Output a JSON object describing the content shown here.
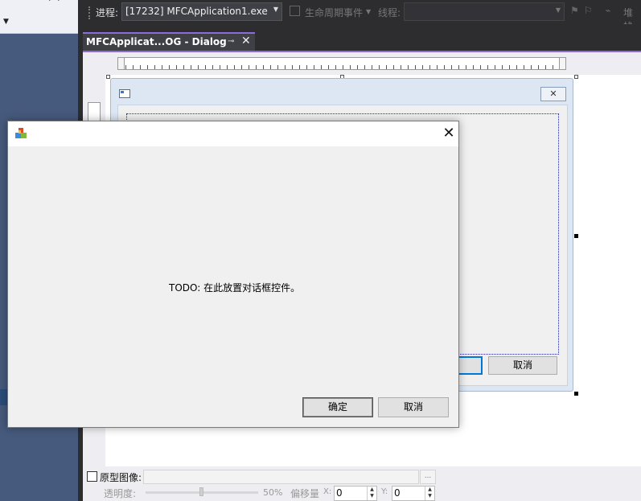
{
  "toolbar": {
    "process_label": "进程:",
    "process_value": "[17232] MFCApplication1.exe",
    "lifecycle_label": "生命周期事件",
    "thread_label": "线程:",
    "thread_value": "",
    "stack_label": "堆栈"
  },
  "tab": {
    "title": "MFCApplicat...OG - Dialog",
    "pin_glyph": "⊸",
    "close_glyph": "✕"
  },
  "design_dialog": {
    "close_glyph": "✕",
    "cancel_label": "取消"
  },
  "run_dialog": {
    "body_text": "TODO: 在此放置对话框控件。",
    "ok_label": "确定",
    "cancel_label": "取消",
    "close_glyph": "✕"
  },
  "bottom_bar": {
    "prototype_label": "原型图像:",
    "browse_label": "...",
    "opacity_label": "透明度:",
    "opacity_value": "50%",
    "opacity_fraction": 0.5,
    "offset_label": "偏移量",
    "x_label": "X:",
    "x_value": "0",
    "y_label": "Y:",
    "y_value": "0"
  },
  "colors": {
    "vs_dark": "#2d2d30",
    "accent": "#8c6cd8",
    "focus_blue": "#0078d7"
  }
}
